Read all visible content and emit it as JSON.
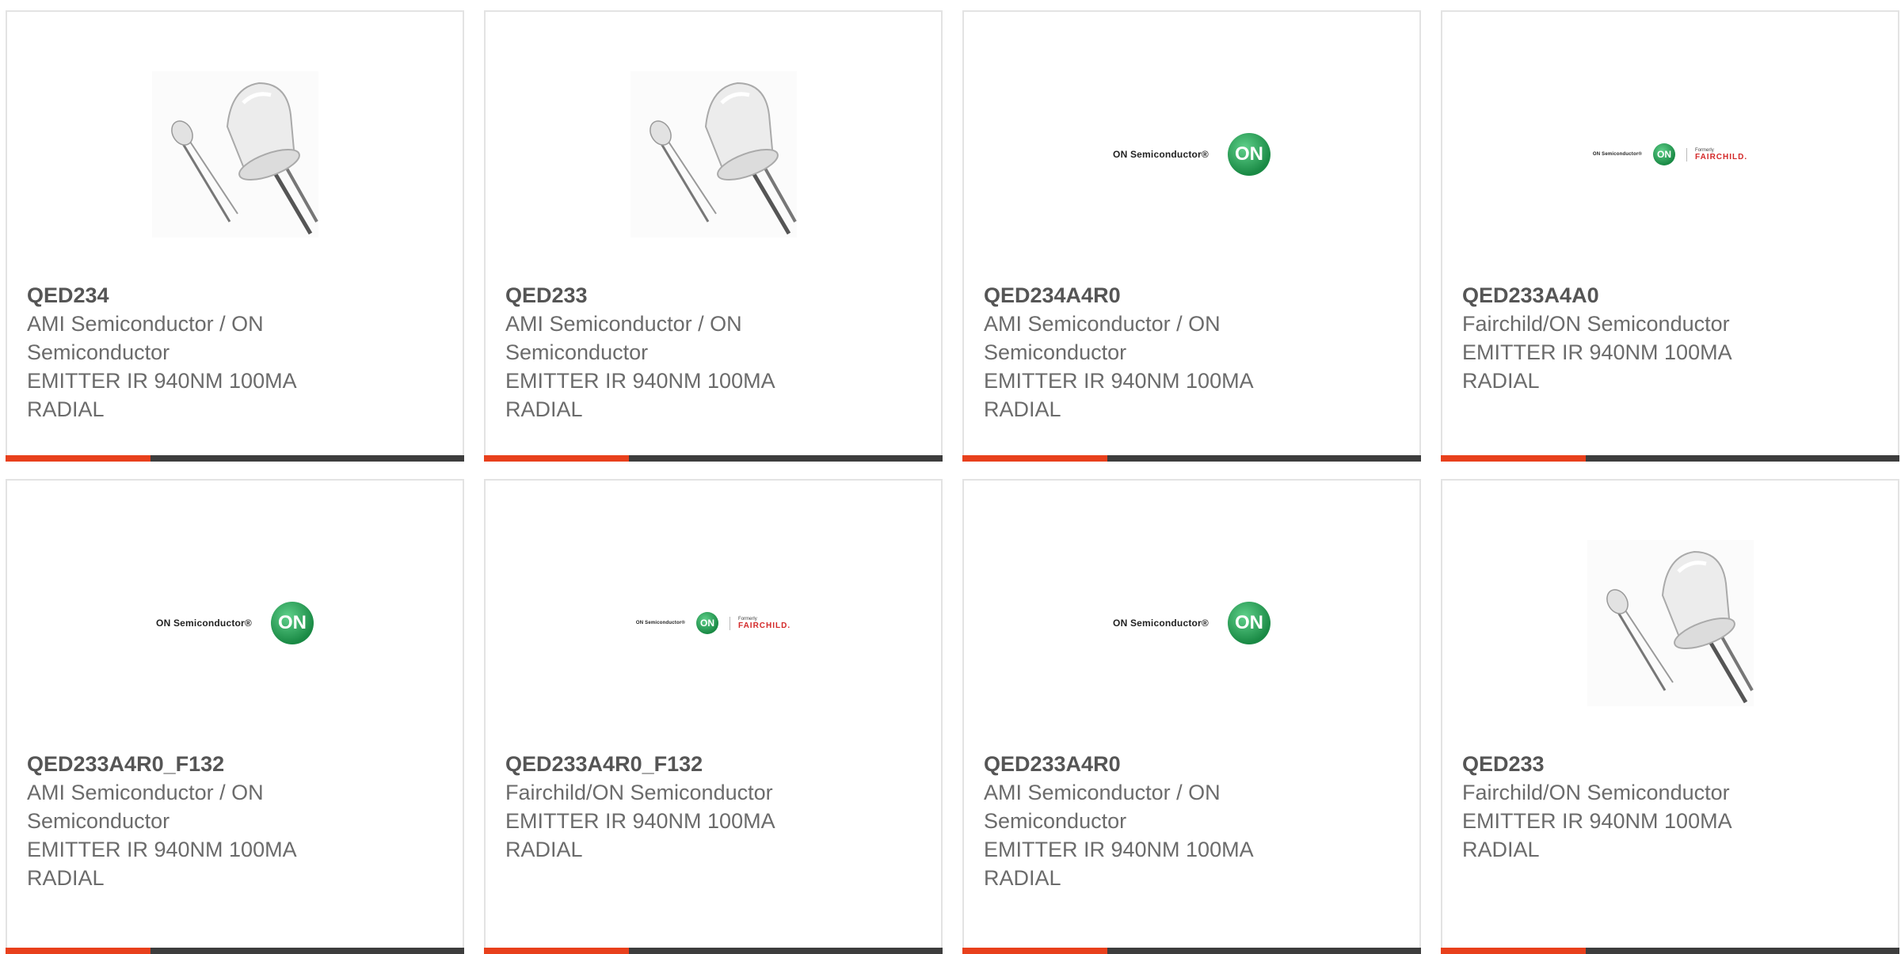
{
  "cards": [
    {
      "part": "QED234",
      "maker": "AMI Semiconductor / ON Semiconductor",
      "desc": "EMITTER IR 940NM 100MA RADIAL",
      "image": "led-photo"
    },
    {
      "part": "QED233",
      "maker": "AMI Semiconductor / ON Semiconductor",
      "desc": "EMITTER IR 940NM 100MA RADIAL",
      "image": "led-photo"
    },
    {
      "part": "QED234A4R0",
      "maker": "AMI Semiconductor / ON Semiconductor",
      "desc": "EMITTER IR 940NM 100MA RADIAL",
      "image": "on-semiconductor-logo"
    },
    {
      "part": "QED233A4A0",
      "maker": "Fairchild/ON Semiconductor",
      "desc": "EMITTER IR 940NM 100MA RADIAL",
      "image": "on-fairchild-logo"
    },
    {
      "part": "QED233A4R0_F132",
      "maker": "AMI Semiconductor / ON Semiconductor",
      "desc": "EMITTER IR 940NM 100MA RADIAL",
      "image": "on-semiconductor-logo"
    },
    {
      "part": "QED233A4R0_F132",
      "maker": "Fairchild/ON Semiconductor",
      "desc": "EMITTER IR 940NM 100MA RADIAL",
      "image": "on-fairchild-logo"
    },
    {
      "part": "QED233A4R0",
      "maker": "AMI Semiconductor / ON Semiconductor",
      "desc": "EMITTER IR 940NM 100MA RADIAL",
      "image": "on-semiconductor-logo"
    },
    {
      "part": "QED233",
      "maker": "Fairchild/ON Semiconductor",
      "desc": "EMITTER IR 940NM 100MA RADIAL",
      "image": "led-photo"
    }
  ],
  "logos": {
    "on_text": "ON Semiconductor®",
    "on_mark": "ON",
    "formerly": "Formerly",
    "fairchild": "FAIRCHILD."
  },
  "colors": {
    "accent": "#e8401c",
    "bar": "#3d3d3d",
    "border": "#e3e3e3",
    "text": "#6b6b6b"
  }
}
